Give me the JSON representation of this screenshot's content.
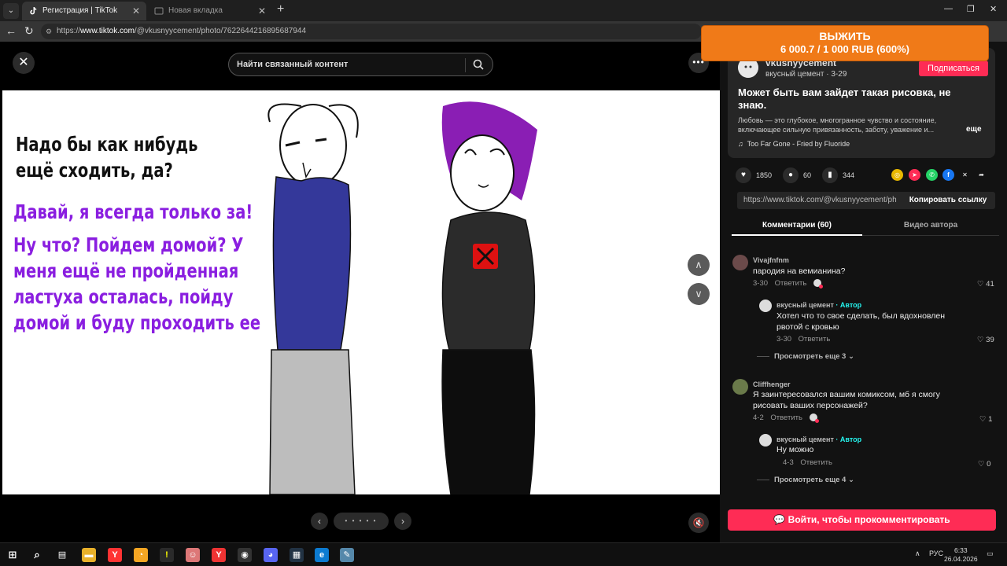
{
  "browser": {
    "tabs": [
      {
        "title": "Регистрация | TikTok"
      },
      {
        "title": "Новая вкладка"
      }
    ],
    "url_host": "www.tiktok.com",
    "url_path": "/@vkusnyycement/photo/7622644216895687944",
    "url_prefix": "https://"
  },
  "viewer": {
    "search_placeholder": "Найти связанный контент",
    "slide_text": {
      "black_lines": [
        "Надо бы как нибудь",
        "ещё сходить, да?"
      ],
      "purple_lines": [
        "Давай, я всегда только за!",
        "Ну что? Пойдем домой? У",
        "меня ещё не пройденная",
        "ластуха осталась, пойду",
        "домой и буду проходить ее"
      ]
    },
    "slide_dots": "• • • • •"
  },
  "overlay": {
    "title": "ВЫЖИТЬ",
    "value": "6 000.7 / 1 000 RUB (600%)"
  },
  "post": {
    "author_name": "vkusnyycement",
    "author_sub": "вкусный цемент · 3-29",
    "follow_label": "Подписаться",
    "title": "Может быть вам зайдет такая рисовка, не знаю.",
    "description": "Любовь — это глубокое, многогранное чувство и состояние, включающее сильную привязанность, заботу, уважение и...",
    "more_label": "еще",
    "music": "Too Far Gone - Fried by Fluoride",
    "likes": "1850",
    "comments_count": "60",
    "saves": "344",
    "link": "https://www.tiktok.com/@vkusnyycement/photo/7622644216895687944",
    "copy_label": "Копировать ссылку"
  },
  "tabs": {
    "comments": "Комментарии (60)",
    "author_videos": "Видео автора"
  },
  "comments": [
    {
      "name": "Vivajfnfnm",
      "text": "пародия на вемианина?",
      "date": "3-30",
      "reply_label": "Ответить",
      "likes": "41",
      "replies": [
        {
          "name": "вкусный цемент",
          "author_tag": "· Автор",
          "text": "Хотел что то свое сделать, был вдохновлен рвотой с кровью",
          "date": "3-30",
          "reply_label": "Ответить",
          "likes": "39"
        }
      ],
      "view_more": "Просмотреть еще 3"
    },
    {
      "name": "Cliffhenger",
      "text": "Я заинтересовался вашим комиксом, мб я смогу рисовать ваших персонажей?",
      "date": "4-2",
      "reply_label": "Ответить",
      "likes": "1",
      "replies": [
        {
          "name": "вкусный цемент",
          "author_tag": "· Автор",
          "text": "Ну можно",
          "date": "4-3",
          "reply_label": "Ответить",
          "likes": "0"
        }
      ],
      "view_more": "Просмотреть еще 4"
    }
  ],
  "login_label": "Войти, чтобы прокомментировать",
  "taskbar": {
    "lang": "РУС",
    "time": "6:33",
    "date": "26.04.2026"
  }
}
